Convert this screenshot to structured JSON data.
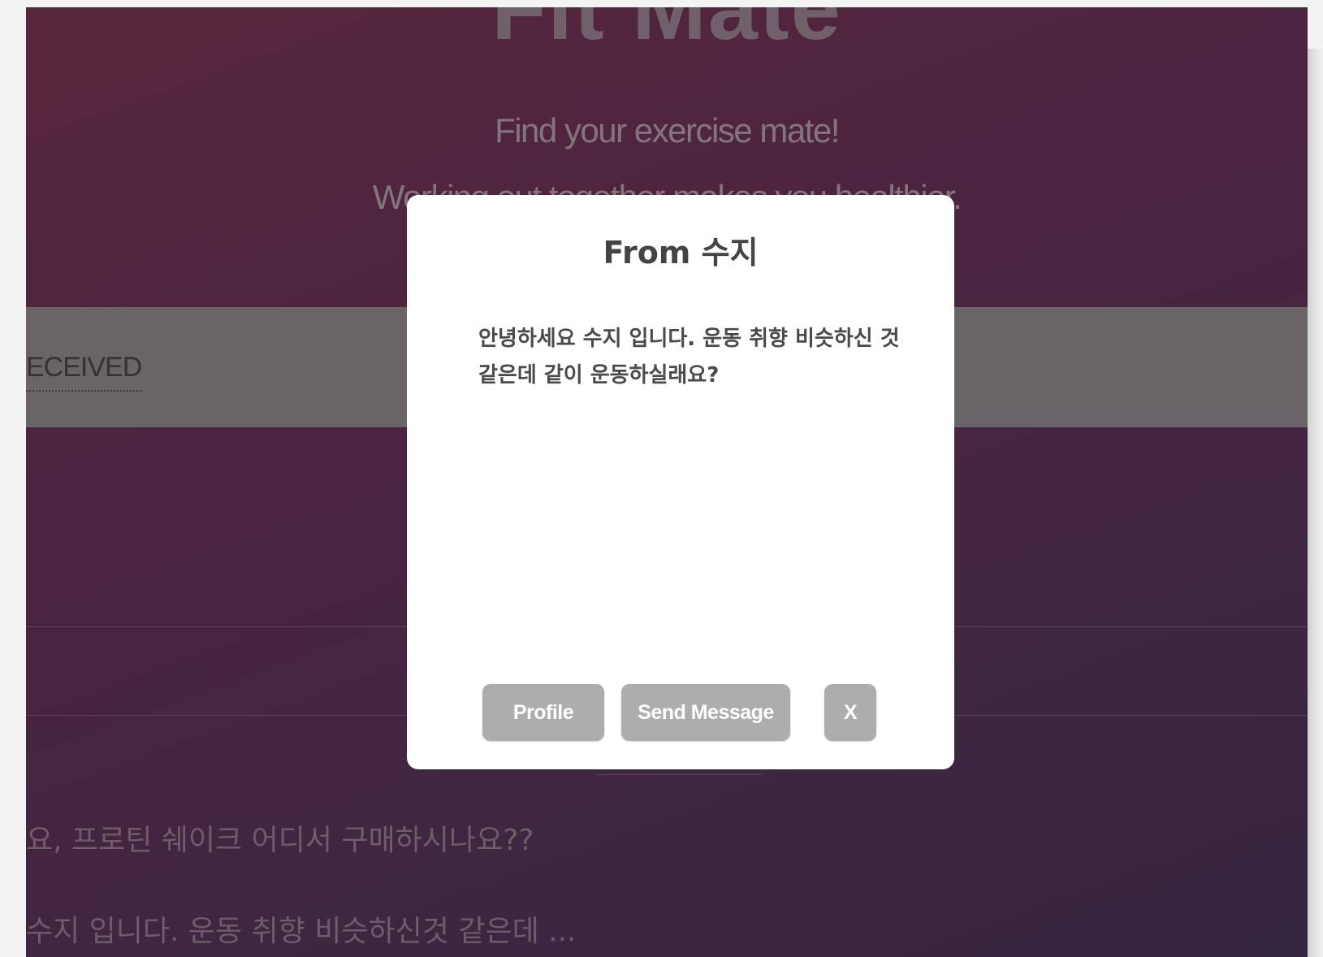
{
  "app": {
    "brand_title": "Fit Mate",
    "tagline": "Find your exercise mate!",
    "subtagline": "Working out together makes you healthier."
  },
  "tabs": {
    "received_label": "ECEIVED"
  },
  "message_list": [
    {
      "preview": "요, 프로틴 쉐이크 어디서 구매하시나요??"
    },
    {
      "preview": "수지 입니다. 운동 취향 비슷하신것 같은데 ..."
    }
  ],
  "modal": {
    "title": "From 수지",
    "body": "안녕하세요 수지 입니다. 운동 취향 비슷하신 것 같은데 같이 운동하실래요?",
    "buttons": {
      "profile_label": "Profile",
      "send_message_label": "Send Message",
      "close_label": "X"
    }
  },
  "colors": {
    "background_gradient_start": "#6b2a45",
    "background_gradient_end": "#3a2a4b",
    "tab_band": "#818080",
    "modal_bg": "#ffffff",
    "button_bg": "#adadad",
    "button_text": "#ffffff"
  }
}
